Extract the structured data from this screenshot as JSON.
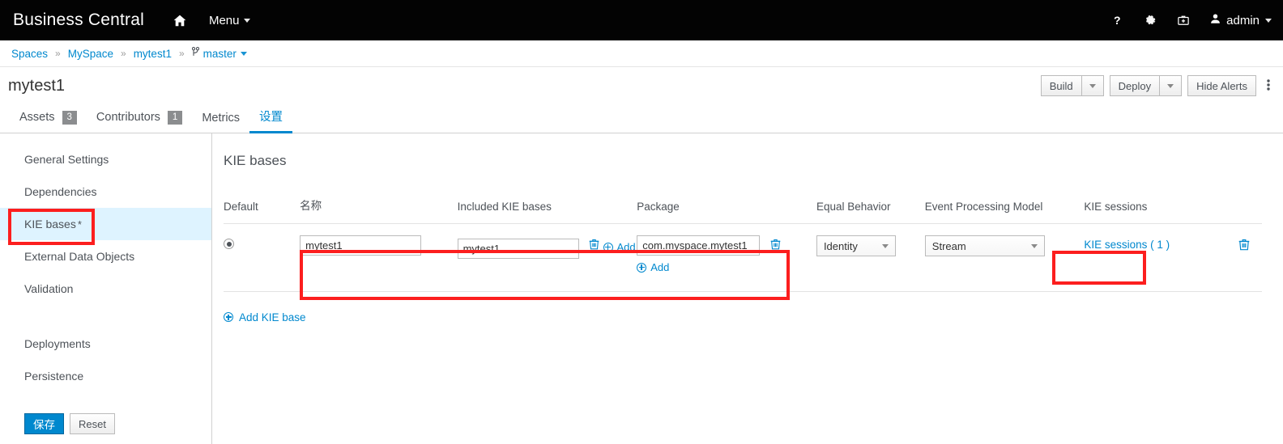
{
  "navbar": {
    "brand": "Business Central",
    "home_icon": "home-icon",
    "menu_label": "Menu",
    "help_icon": "?",
    "gear_icon": "gear-icon",
    "kit_icon": "toolkit-icon",
    "user_icon": "user-icon",
    "user_name": "admin"
  },
  "breadcrumb": {
    "items": [
      "Spaces",
      "MySpace",
      "mytest1"
    ],
    "separator": "»",
    "branch": "master",
    "branch_icon": "branch-icon"
  },
  "title_bar": {
    "title": "mytest1",
    "build_label": "Build",
    "deploy_label": "Deploy",
    "hide_alerts_label": "Hide Alerts",
    "kebab_icon": "vertical-kebab-icon"
  },
  "tabs": [
    {
      "label": "Assets",
      "badge": "3",
      "active": false
    },
    {
      "label": "Contributors",
      "badge": "1",
      "active": false
    },
    {
      "label": "Metrics",
      "badge": "",
      "active": false
    },
    {
      "label": "设置",
      "badge": "",
      "active": true
    }
  ],
  "sidebar": {
    "items": [
      {
        "label": "General Settings",
        "modified": false,
        "active": false
      },
      {
        "label": "Dependencies",
        "modified": false,
        "active": false
      },
      {
        "label": "KIE bases",
        "modified": true,
        "active": true
      },
      {
        "label": "External Data Objects",
        "modified": false,
        "active": false
      },
      {
        "label": "Validation",
        "modified": false,
        "active": false
      },
      {
        "label": "Deployments",
        "modified": false,
        "active": false
      },
      {
        "label": "Persistence",
        "modified": false,
        "active": false
      }
    ],
    "modified_marker": "*",
    "save_label": "保存",
    "reset_label": "Reset"
  },
  "main": {
    "panel_title": "KIE bases",
    "columns": [
      "Default",
      "名称",
      "Included KIE bases",
      "Package",
      "Equal Behavior",
      "Event Processing Model",
      "KIE sessions"
    ],
    "row": {
      "default_selected": true,
      "name": "mytest1",
      "included_kie_base": "mytest1",
      "included_add_label": "Add",
      "package": "com.myspace.mytest1",
      "package_add_label": "Add",
      "equal_behavior": "Identity",
      "event_processing_model": "Stream",
      "kie_sessions_link": "KIE sessions ( 1 )",
      "delete_icon": "trash-icon"
    },
    "add_kie_base_label": "Add KIE base"
  },
  "annotations": {
    "accent_color": "#fc1e1e",
    "boxes": [
      "sidebar-kie-bases",
      "kie-base-row",
      "kie-sessions-link"
    ]
  },
  "colors": {
    "navbar_bg": "#030303",
    "link": "#0088ce",
    "active_row": "#def3ff",
    "badge_bg": "#8b8d8f"
  }
}
